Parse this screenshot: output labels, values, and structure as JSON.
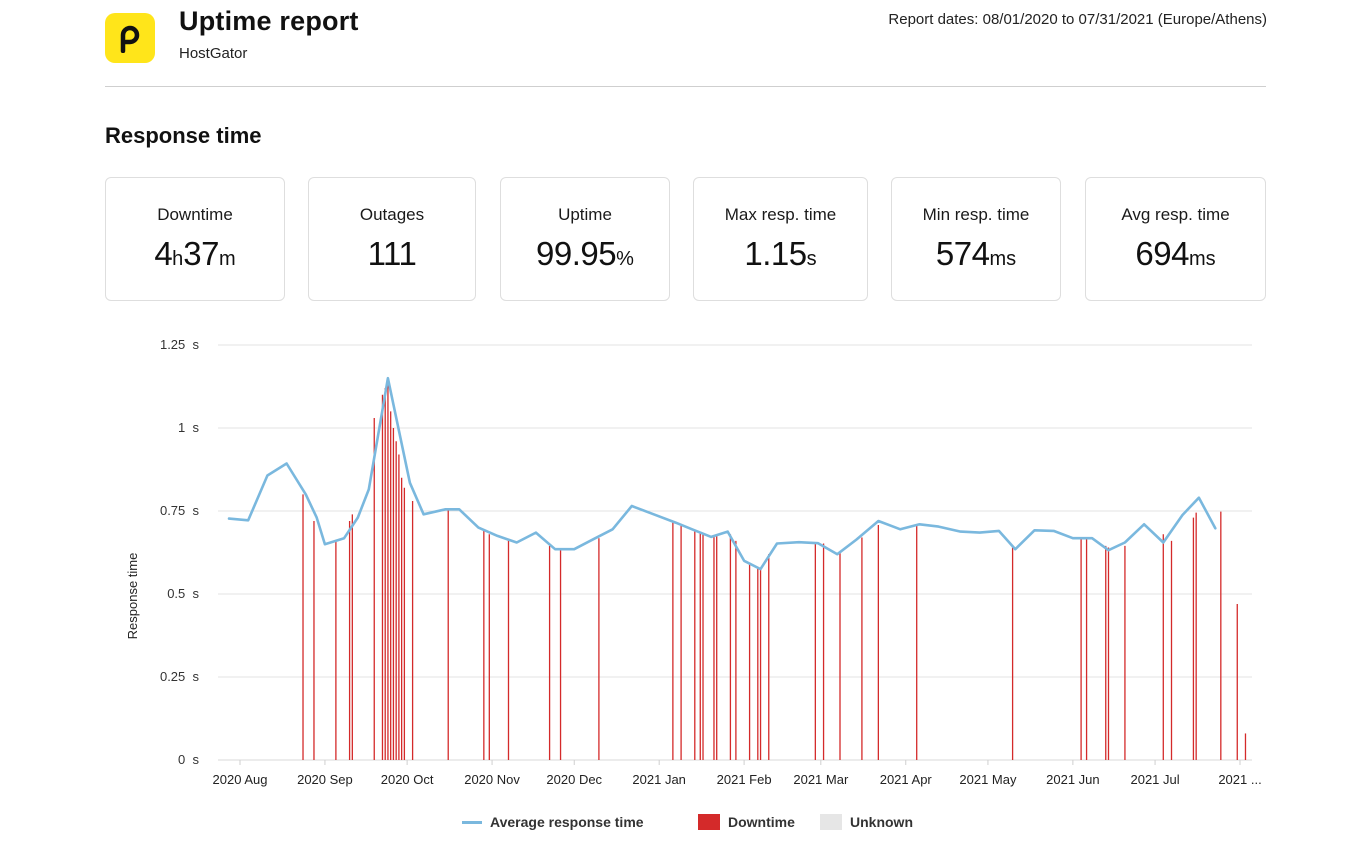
{
  "header": {
    "title": "Uptime report",
    "subtitle": "HostGator",
    "report_dates": "Report dates: 08/01/2020 to 07/31/2021 (Europe/Athens)",
    "logo_icon": "p-logo-icon",
    "logo_color": "#ffe51a"
  },
  "section": {
    "title": "Response time"
  },
  "stats": [
    {
      "label": "Downtime",
      "value_parts": [
        "4",
        "h",
        "37",
        "m"
      ]
    },
    {
      "label": "Outages",
      "value_parts": [
        "111"
      ]
    },
    {
      "label": "Uptime",
      "value_parts": [
        "99.95",
        "%"
      ]
    },
    {
      "label": "Max resp. time",
      "value_parts": [
        "1.15",
        "s"
      ]
    },
    {
      "label": "Min resp. time",
      "value_parts": [
        "574",
        "ms"
      ]
    },
    {
      "label": "Avg resp. time",
      "value_parts": [
        "694",
        "ms"
      ]
    }
  ],
  "chart_data": {
    "type": "line",
    "title": "",
    "xlabel": "",
    "ylabel": "Response time",
    "ylim": [
      0,
      1.25
    ],
    "y_ticks": [
      {
        "value": 0,
        "label": "0  s"
      },
      {
        "value": 0.25,
        "label": "0.25  s"
      },
      {
        "value": 0.5,
        "label": "0.5  s"
      },
      {
        "value": 0.75,
        "label": "0.75  s"
      },
      {
        "value": 1,
        "label": "1  s"
      },
      {
        "value": 1.25,
        "label": "1.25  s"
      }
    ],
    "x_unit": "days since 2020-08-01",
    "xlim": [
      -4,
      368
    ],
    "x_ticks": [
      {
        "day": 0,
        "label": "2020 Aug"
      },
      {
        "day": 31,
        "label": "2020 Sep"
      },
      {
        "day": 61,
        "label": "2020 Oct"
      },
      {
        "day": 92,
        "label": "2020 Nov"
      },
      {
        "day": 122,
        "label": "2020 Dec"
      },
      {
        "day": 153,
        "label": "2021 Jan"
      },
      {
        "day": 184,
        "label": "2021 Feb"
      },
      {
        "day": 212,
        "label": "2021 Mar"
      },
      {
        "day": 243,
        "label": "2021 Apr"
      },
      {
        "day": 273,
        "label": "2021 May"
      },
      {
        "day": 304,
        "label": "2021 Jun"
      },
      {
        "day": 334,
        "label": "2021 Jul"
      },
      {
        "day": 365,
        "label": "2021 ..."
      }
    ],
    "grid": true,
    "legend_position": "bottom-center",
    "series": [
      {
        "name": "Average response time",
        "color": "#7ab8de",
        "points": [
          [
            -4,
            0.727
          ],
          [
            3,
            0.722
          ],
          [
            10,
            0.857
          ],
          [
            17,
            0.893
          ],
          [
            24,
            0.8
          ],
          [
            28,
            0.73
          ],
          [
            31,
            0.65
          ],
          [
            38,
            0.668
          ],
          [
            43,
            0.73
          ],
          [
            47,
            0.815
          ],
          [
            54,
            1.15
          ],
          [
            62,
            0.835
          ],
          [
            67,
            0.74
          ],
          [
            75,
            0.755
          ],
          [
            80,
            0.755
          ],
          [
            87,
            0.7
          ],
          [
            94,
            0.675
          ],
          [
            101,
            0.655
          ],
          [
            108,
            0.685
          ],
          [
            115,
            0.635
          ],
          [
            122,
            0.635
          ],
          [
            129,
            0.665
          ],
          [
            136,
            0.695
          ],
          [
            143,
            0.765
          ],
          [
            151,
            0.74
          ],
          [
            159,
            0.715
          ],
          [
            165,
            0.695
          ],
          [
            172,
            0.672
          ],
          [
            178,
            0.688
          ],
          [
            184,
            0.6
          ],
          [
            190,
            0.575
          ],
          [
            196,
            0.652
          ],
          [
            204,
            0.656
          ],
          [
            211,
            0.653
          ],
          [
            218,
            0.62
          ],
          [
            225,
            0.664
          ],
          [
            233,
            0.72
          ],
          [
            241,
            0.695
          ],
          [
            248,
            0.71
          ],
          [
            255,
            0.703
          ],
          [
            263,
            0.688
          ],
          [
            270,
            0.685
          ],
          [
            277,
            0.69
          ],
          [
            283,
            0.635
          ],
          [
            290,
            0.692
          ],
          [
            297,
            0.69
          ],
          [
            304,
            0.668
          ],
          [
            311,
            0.668
          ],
          [
            317,
            0.632
          ],
          [
            323,
            0.655
          ],
          [
            330,
            0.71
          ],
          [
            337,
            0.655
          ],
          [
            344,
            0.738
          ],
          [
            350,
            0.79
          ],
          [
            356,
            0.698
          ]
        ]
      }
    ],
    "downtime": {
      "name": "Downtime",
      "color": "#d42a2a",
      "events": [
        {
          "day": 23,
          "value": 0.8
        },
        {
          "day": 27,
          "value": 0.72
        },
        {
          "day": 35,
          "value": 0.66
        },
        {
          "day": 40,
          "value": 0.72
        },
        {
          "day": 41,
          "value": 0.74
        },
        {
          "day": 49,
          "value": 1.03
        },
        {
          "day": 52,
          "value": 1.1
        },
        {
          "day": 53,
          "value": 1.12
        },
        {
          "day": 54,
          "value": 1.13
        },
        {
          "day": 55,
          "value": 1.05
        },
        {
          "day": 56,
          "value": 1.0
        },
        {
          "day": 57,
          "value": 0.96
        },
        {
          "day": 58,
          "value": 0.92
        },
        {
          "day": 59,
          "value": 0.85
        },
        {
          "day": 60,
          "value": 0.82
        },
        {
          "day": 63,
          "value": 0.78
        },
        {
          "day": 76,
          "value": 0.755
        },
        {
          "day": 89,
          "value": 0.69
        },
        {
          "day": 91,
          "value": 0.68
        },
        {
          "day": 98,
          "value": 0.665
        },
        {
          "day": 113,
          "value": 0.645
        },
        {
          "day": 117,
          "value": 0.632
        },
        {
          "day": 131,
          "value": 0.668
        },
        {
          "day": 158,
          "value": 0.72
        },
        {
          "day": 161,
          "value": 0.705
        },
        {
          "day": 166,
          "value": 0.69
        },
        {
          "day": 168,
          "value": 0.685
        },
        {
          "day": 169,
          "value": 0.68
        },
        {
          "day": 173,
          "value": 0.672
        },
        {
          "day": 174,
          "value": 0.675
        },
        {
          "day": 179,
          "value": 0.68
        },
        {
          "day": 181,
          "value": 0.66
        },
        {
          "day": 186,
          "value": 0.59
        },
        {
          "day": 189,
          "value": 0.578
        },
        {
          "day": 190,
          "value": 0.575
        },
        {
          "day": 193,
          "value": 0.62
        },
        {
          "day": 210,
          "value": 0.653
        },
        {
          "day": 213,
          "value": 0.652
        },
        {
          "day": 219,
          "value": 0.625
        },
        {
          "day": 227,
          "value": 0.67
        },
        {
          "day": 233,
          "value": 0.708
        },
        {
          "day": 247,
          "value": 0.705
        },
        {
          "day": 282,
          "value": 0.645
        },
        {
          "day": 307,
          "value": 0.668
        },
        {
          "day": 309,
          "value": 0.668
        },
        {
          "day": 316,
          "value": 0.645
        },
        {
          "day": 317,
          "value": 0.64
        },
        {
          "day": 323,
          "value": 0.645
        },
        {
          "day": 337,
          "value": 0.68
        },
        {
          "day": 340,
          "value": 0.66
        },
        {
          "day": 348,
          "value": 0.73
        },
        {
          "day": 349,
          "value": 0.745
        },
        {
          "day": 358,
          "value": 0.748
        },
        {
          "day": 364,
          "value": 0.47
        },
        {
          "day": 367,
          "value": 0.08
        }
      ]
    },
    "unknown": {
      "name": "Unknown",
      "color": "#e6e6e6"
    }
  },
  "legend": [
    {
      "label": "Average response time",
      "kind": "line",
      "color": "#7ab8de"
    },
    {
      "label": "Downtime",
      "kind": "swatch",
      "color": "#d42a2a"
    },
    {
      "label": "Unknown",
      "kind": "swatch",
      "color": "#e6e6e6"
    }
  ]
}
